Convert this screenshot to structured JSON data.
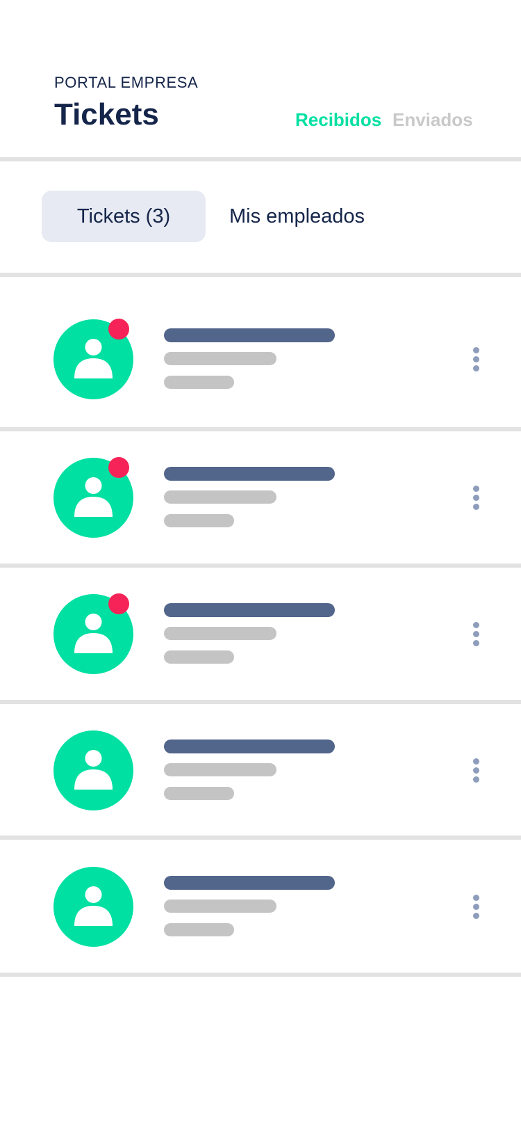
{
  "header": {
    "eyebrow": "PORTAL EMPRESA",
    "title": "Tickets",
    "segments": [
      {
        "label": "Recibidos",
        "active": true
      },
      {
        "label": "Enviados",
        "active": false
      }
    ]
  },
  "tabs": [
    {
      "label": "Tickets (3)",
      "active": true
    },
    {
      "label": "Mis empleados",
      "active": false
    }
  ],
  "tickets": [
    {
      "unread": true
    },
    {
      "unread": true
    },
    {
      "unread": true
    },
    {
      "unread": false
    },
    {
      "unread": false
    }
  ],
  "colors": {
    "accent": "#00e0a2",
    "text": "#15254a",
    "muted": "#c9c9c9",
    "badge": "#f52357",
    "placeholder_primary": "#52658a",
    "placeholder_secondary": "#c4c4c4",
    "kebab": "#8d9dbb",
    "divider": "#e2e2e2",
    "tab_active_bg": "#e7eaf2"
  },
  "icons": {
    "avatar": "user-avatar-icon",
    "menu": "more-vertical-icon",
    "notification": "notification-dot-icon"
  }
}
